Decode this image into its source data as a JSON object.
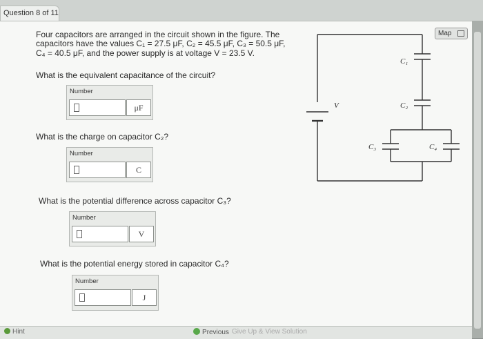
{
  "tab": {
    "title": "Question 8 of 11"
  },
  "problem": {
    "line1": "Four capacitors are arranged in the circuit shown in the figure. The",
    "line2": "capacitors have the values C₁ = 27.5 μF, C₂ = 45.5 μF, C₃ = 50.5 μF,",
    "line3": "C₄ = 40.5 μF, and the power supply is at voltage V = 23.5 V."
  },
  "questions": [
    {
      "text": "What is the equivalent capacitance of the circuit?",
      "label": "Number",
      "value": "",
      "unit": "μF"
    },
    {
      "text": "What is the charge on capacitor C₂?",
      "label": "Number",
      "value": "",
      "unit": "C"
    },
    {
      "text": "What is the potential difference across capacitor C₃?",
      "label": "Number",
      "value": "",
      "unit": "V"
    },
    {
      "text": "What is the potential energy stored in capacitor C₄?",
      "label": "Number",
      "value": "",
      "unit": "J"
    }
  ],
  "map": {
    "label": "Map"
  },
  "circuit": {
    "c1": "C₁",
    "c2": "C₂",
    "c3": "C₃",
    "c4": "C₄",
    "v": "V"
  },
  "footer": {
    "hint": "Hint",
    "previous": "Previous",
    "giveup": "Give Up & View Solution"
  },
  "colors": {
    "panel": "#f7f8f6",
    "answer_box": "#e9ebe8",
    "hint_green": "#5a9a3a"
  },
  "icons": {
    "hint": "hint-icon",
    "previous": "previous-icon",
    "map": "map-grid-icon",
    "cursor": "text-cursor-icon"
  }
}
